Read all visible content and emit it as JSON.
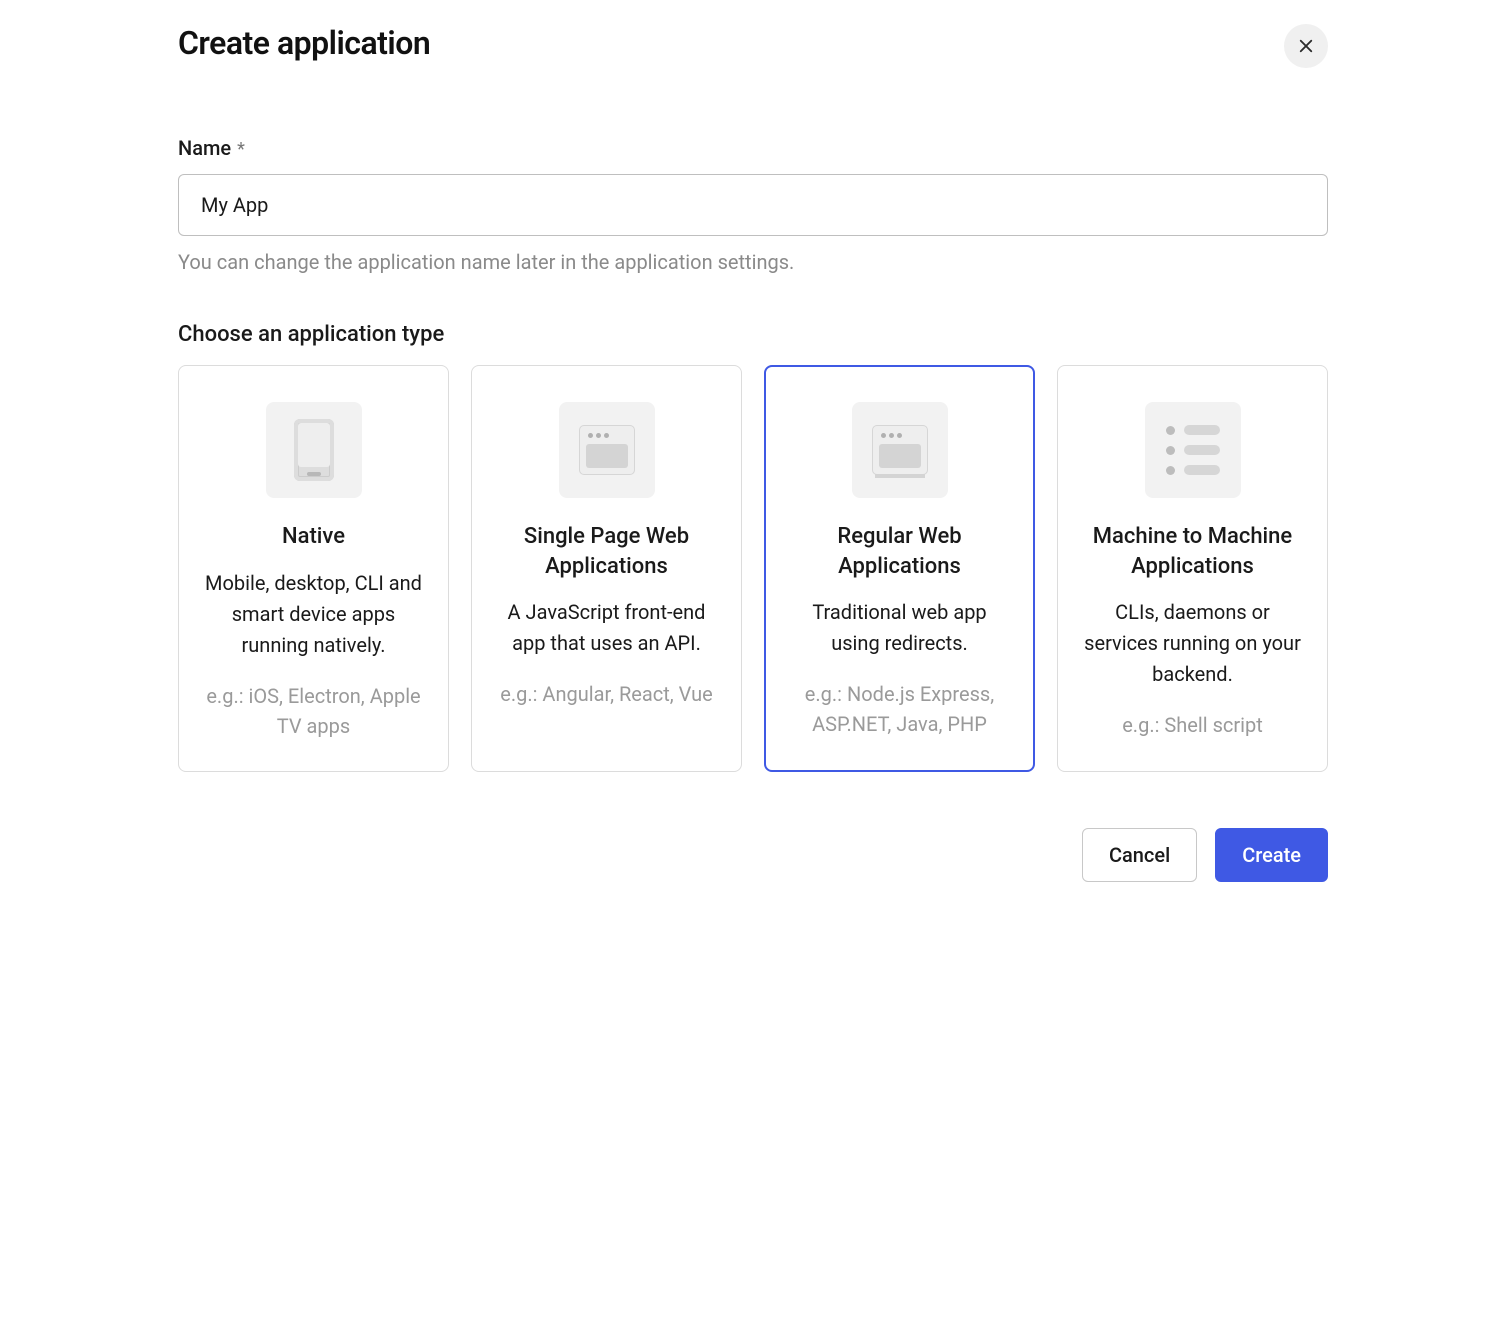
{
  "dialog": {
    "title": "Create application"
  },
  "name_field": {
    "label": "Name",
    "required_indicator": "*",
    "value": "My App",
    "helper": "You can change the application name later in the application settings."
  },
  "type_section": {
    "label": "Choose an application type",
    "selected_index": 2,
    "cards": [
      {
        "id": "native",
        "title": "Native",
        "description": "Mobile, desktop, CLI and smart device apps running natively.",
        "example": "e.g.: iOS, Electron, Apple TV apps"
      },
      {
        "id": "spa",
        "title": "Single Page Web Applications",
        "description": "A JavaScript front-end app that uses an API.",
        "example": "e.g.: Angular, React, Vue"
      },
      {
        "id": "regular",
        "title": "Regular Web Applications",
        "description": "Traditional web app using redirects.",
        "example": "e.g.: Node.js Express, ASP.NET, Java, PHP"
      },
      {
        "id": "m2m",
        "title": "Machine to Machine Applications",
        "description": "CLIs, daemons or services running on your backend.",
        "example": "e.g.: Shell script"
      }
    ]
  },
  "footer": {
    "cancel": "Cancel",
    "create": "Create"
  }
}
